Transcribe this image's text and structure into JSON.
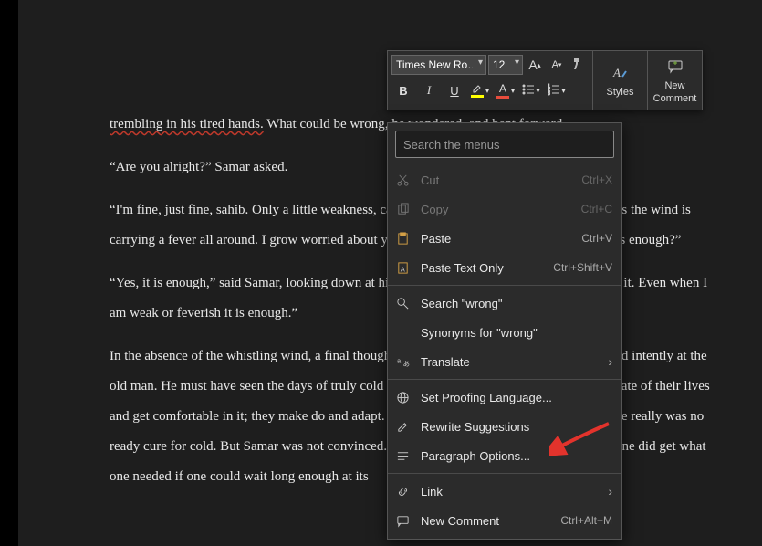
{
  "toolbar": {
    "font_name": "Times New Ro…",
    "font_size": "12",
    "bold": "B",
    "italic": "I",
    "underline": "U",
    "styles_label": "Styles",
    "new_comment_line1": "New",
    "new_comment_line2": "Comment"
  },
  "document": {
    "p1_a": "trembling in his tired hands.",
    "p1_b": " What could be wrong, he wondered, and bent forward.",
    "p2": "“Are you alright?” Samar asked.",
    "p3": "“I'm fine, just fine, sahib. Only a little weakness, catch a fever. These things disappear perhaps the wind is carrying a fever all around. I grow worried about you, sahib. Are you sure that coat of yours is enough?”",
    "p4": "“Yes, it is enough,” said Samar, looking down at his blanket about his shoulders. “I'm used to it. Even when I am weak or feverish it is enough.”",
    "p5": "In the absence of the whistling wind, a final thought came to him. Here was Samar, who stared intently at the old man.  He must have seen the days of truly cold winters. People truly were used to the climate of their lives and get comfortable in it; they make do and adapt. That could be true, he must think, that there really was no ready cure for cold. But Samar was not convinced. And when everything was said and done one did get what one needed if one could wait long enough at its"
  },
  "menu": {
    "search_placeholder": "Search the menus",
    "cut": "Cut",
    "cut_key": "Ctrl+X",
    "copy": "Copy",
    "copy_key": "Ctrl+C",
    "paste": "Paste",
    "paste_key": "Ctrl+V",
    "paste_text": "Paste Text Only",
    "paste_text_key": "Ctrl+Shift+V",
    "search_word": "Search \"wrong\"",
    "synonyms": "Synonyms for \"wrong\"",
    "translate": "Translate",
    "proofing": "Set Proofing Language...",
    "rewrite": "Rewrite Suggestions",
    "paragraph": "Paragraph Options...",
    "link": "Link",
    "new_comment": "New Comment",
    "new_comment_key": "Ctrl+Alt+M"
  }
}
